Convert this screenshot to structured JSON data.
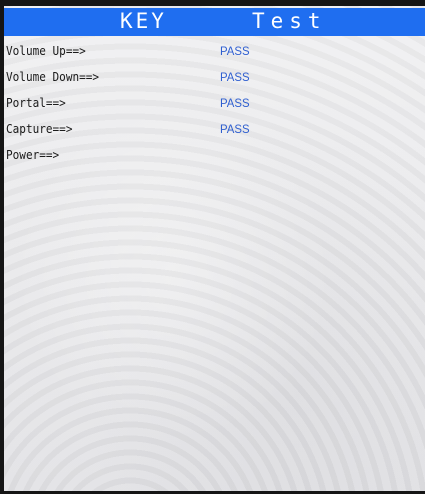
{
  "header": {
    "title_left": "KEY",
    "title_right": "Test",
    "background_color": "#1f6ef0"
  },
  "keys": [
    {
      "label": "Volume Up==>",
      "status": "PASS"
    },
    {
      "label": "Volume Down==>",
      "status": "PASS"
    },
    {
      "label": "Portal==>",
      "status": "PASS"
    },
    {
      "label": "Capture==>",
      "status": "PASS"
    },
    {
      "label": "Power==>",
      "status": ""
    }
  ],
  "colors": {
    "pass": "#2f5fd0",
    "label": "#1b1b1b"
  }
}
